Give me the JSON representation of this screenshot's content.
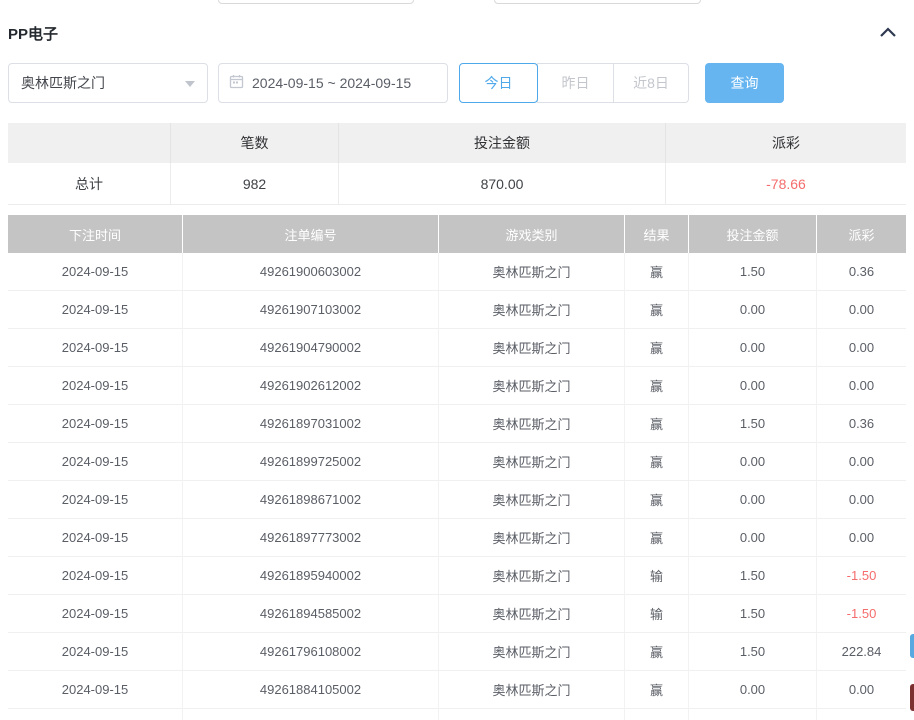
{
  "panel": {
    "title": "PP电子",
    "collapse_icon": "chevron-up-icon"
  },
  "filters": {
    "game_select": {
      "value": "奥林匹斯之门"
    },
    "date_picker": {
      "value": "2024-09-15 ~ 2024-09-15"
    },
    "quick_ranges": [
      {
        "label": "今日",
        "active": true
      },
      {
        "label": "昨日",
        "active": false
      },
      {
        "label": "近8日",
        "active": false
      }
    ],
    "search_label": "查询"
  },
  "summary_table": {
    "headers": [
      "",
      "笔数",
      "投注金额",
      "派彩"
    ],
    "total_row": {
      "label": "总计",
      "count": "982",
      "bet_amount": "870.00",
      "payout": "-78.66"
    }
  },
  "bet_table": {
    "headers": [
      "下注时间",
      "注单编号",
      "游戏类别",
      "结果",
      "投注金额",
      "派彩"
    ],
    "rows": [
      [
        "2024-09-15",
        "49261900603002",
        "奥林匹斯之门",
        "赢",
        "1.50",
        "0.36"
      ],
      [
        "2024-09-15",
        "49261907103002",
        "奥林匹斯之门",
        "赢",
        "0.00",
        "0.00"
      ],
      [
        "2024-09-15",
        "49261904790002",
        "奥林匹斯之门",
        "赢",
        "0.00",
        "0.00"
      ],
      [
        "2024-09-15",
        "49261902612002",
        "奥林匹斯之门",
        "赢",
        "0.00",
        "0.00"
      ],
      [
        "2024-09-15",
        "49261897031002",
        "奥林匹斯之门",
        "赢",
        "1.50",
        "0.36"
      ],
      [
        "2024-09-15",
        "49261899725002",
        "奥林匹斯之门",
        "赢",
        "0.00",
        "0.00"
      ],
      [
        "2024-09-15",
        "49261898671002",
        "奥林匹斯之门",
        "赢",
        "0.00",
        "0.00"
      ],
      [
        "2024-09-15",
        "49261897773002",
        "奥林匹斯之门",
        "赢",
        "0.00",
        "0.00"
      ],
      [
        "2024-09-15",
        "49261895940002",
        "奥林匹斯之门",
        "输",
        "1.50",
        "-1.50"
      ],
      [
        "2024-09-15",
        "49261894585002",
        "奥林匹斯之门",
        "输",
        "1.50",
        "-1.50"
      ],
      [
        "2024-09-15",
        "49261796108002",
        "奥林匹斯之门",
        "赢",
        "1.50",
        "222.84"
      ],
      [
        "2024-09-15",
        "49261884105002",
        "奥林匹斯之门",
        "赢",
        "0.00",
        "0.00"
      ]
    ]
  },
  "colors": {
    "accent_blue": "#4fa8ea",
    "search_button_bg": "#66b5f0",
    "negative_red": "#f56c6c",
    "table_header_gray": "#c4c4c4"
  }
}
